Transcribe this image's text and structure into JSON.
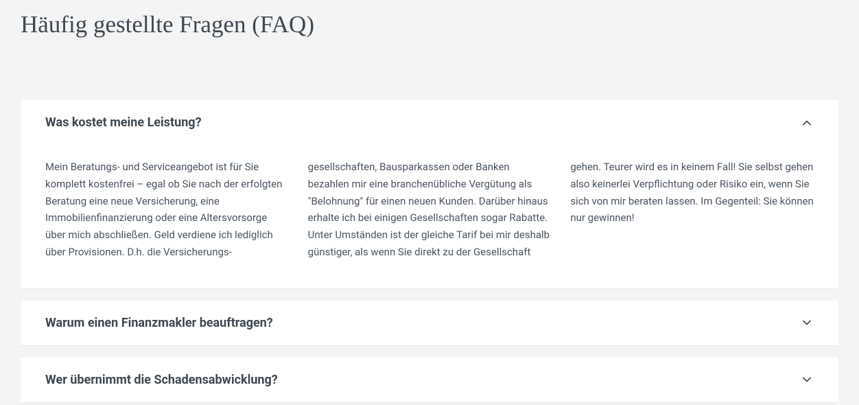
{
  "page": {
    "title": "Häufig gestellte Fragen (FAQ)"
  },
  "faq": {
    "items": [
      {
        "title": "Was kostet meine Leistung?",
        "expanded": true,
        "content": "Mein Beratungs- und Serviceangebot ist für Sie komplett kostenfrei – egal ob Sie nach der erfolgten Beratung eine neue Versicherung, eine Immobilienfinanzierung oder eine Altersvorsorge über mich abschließen. Geld verdiene ich lediglich über Provisionen. D.h. die Versicherungs-gesellschaften, Bausparkassen oder Banken bezahlen mir eine branchenübliche Vergütung als \"Belohnung\" für einen neuen Kunden. Darüber hinaus erhalte ich bei einigen Gesellschaften sogar Rabatte. Unter Umständen ist der gleiche Tarif bei mir deshalb günstiger, als wenn Sie direkt zu der Gesellschaft gehen. Teurer wird es in keinem Fall! Sie selbst gehen also keinerlei Verpflichtung oder Risiko ein, wenn Sie sich von mir beraten lassen. Im Gegenteil: Sie können nur gewinnen!"
      },
      {
        "title": "Warum einen Finanzmakler beauftragen?",
        "expanded": false,
        "content": ""
      },
      {
        "title": "Wer übernimmt die Schadensabwicklung?",
        "expanded": false,
        "content": ""
      }
    ]
  }
}
